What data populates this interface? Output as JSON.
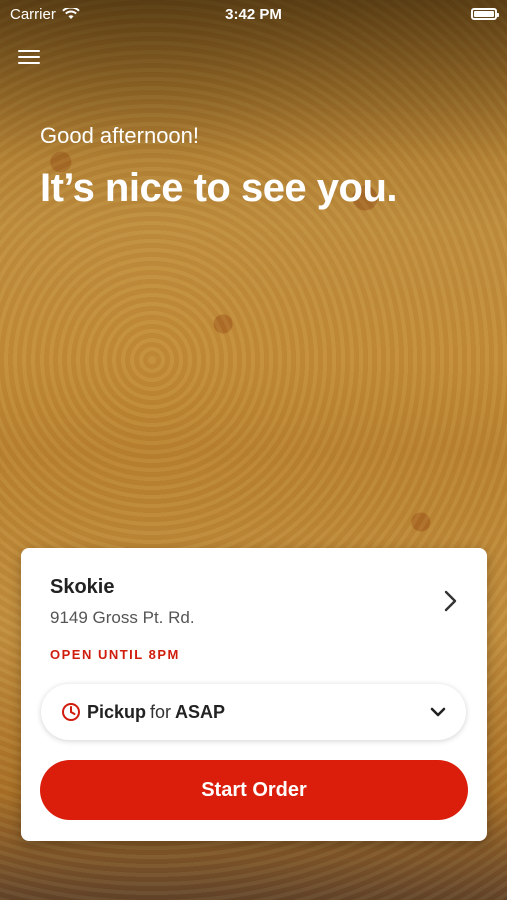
{
  "status_bar": {
    "carrier": "Carrier",
    "time": "3:42 PM",
    "battery_level": 1.0
  },
  "greeting": {
    "small": "Good afternoon!",
    "big": "It’s nice to see you."
  },
  "store": {
    "name": "Skokie",
    "address": "9149 Gross Pt. Rd.",
    "hours": "OPEN UNTIL 8PM"
  },
  "order_mode": {
    "type": "Pickup",
    "connector": "for",
    "time": "ASAP"
  },
  "actions": {
    "start_order": "Start Order"
  },
  "colors": {
    "accent": "#db1d0b",
    "hours_text": "#d01c0c"
  },
  "icons": [
    "wifi-icon",
    "battery-icon",
    "menu-icon",
    "chevron-right-icon",
    "clock-icon",
    "chevron-down-icon"
  ]
}
